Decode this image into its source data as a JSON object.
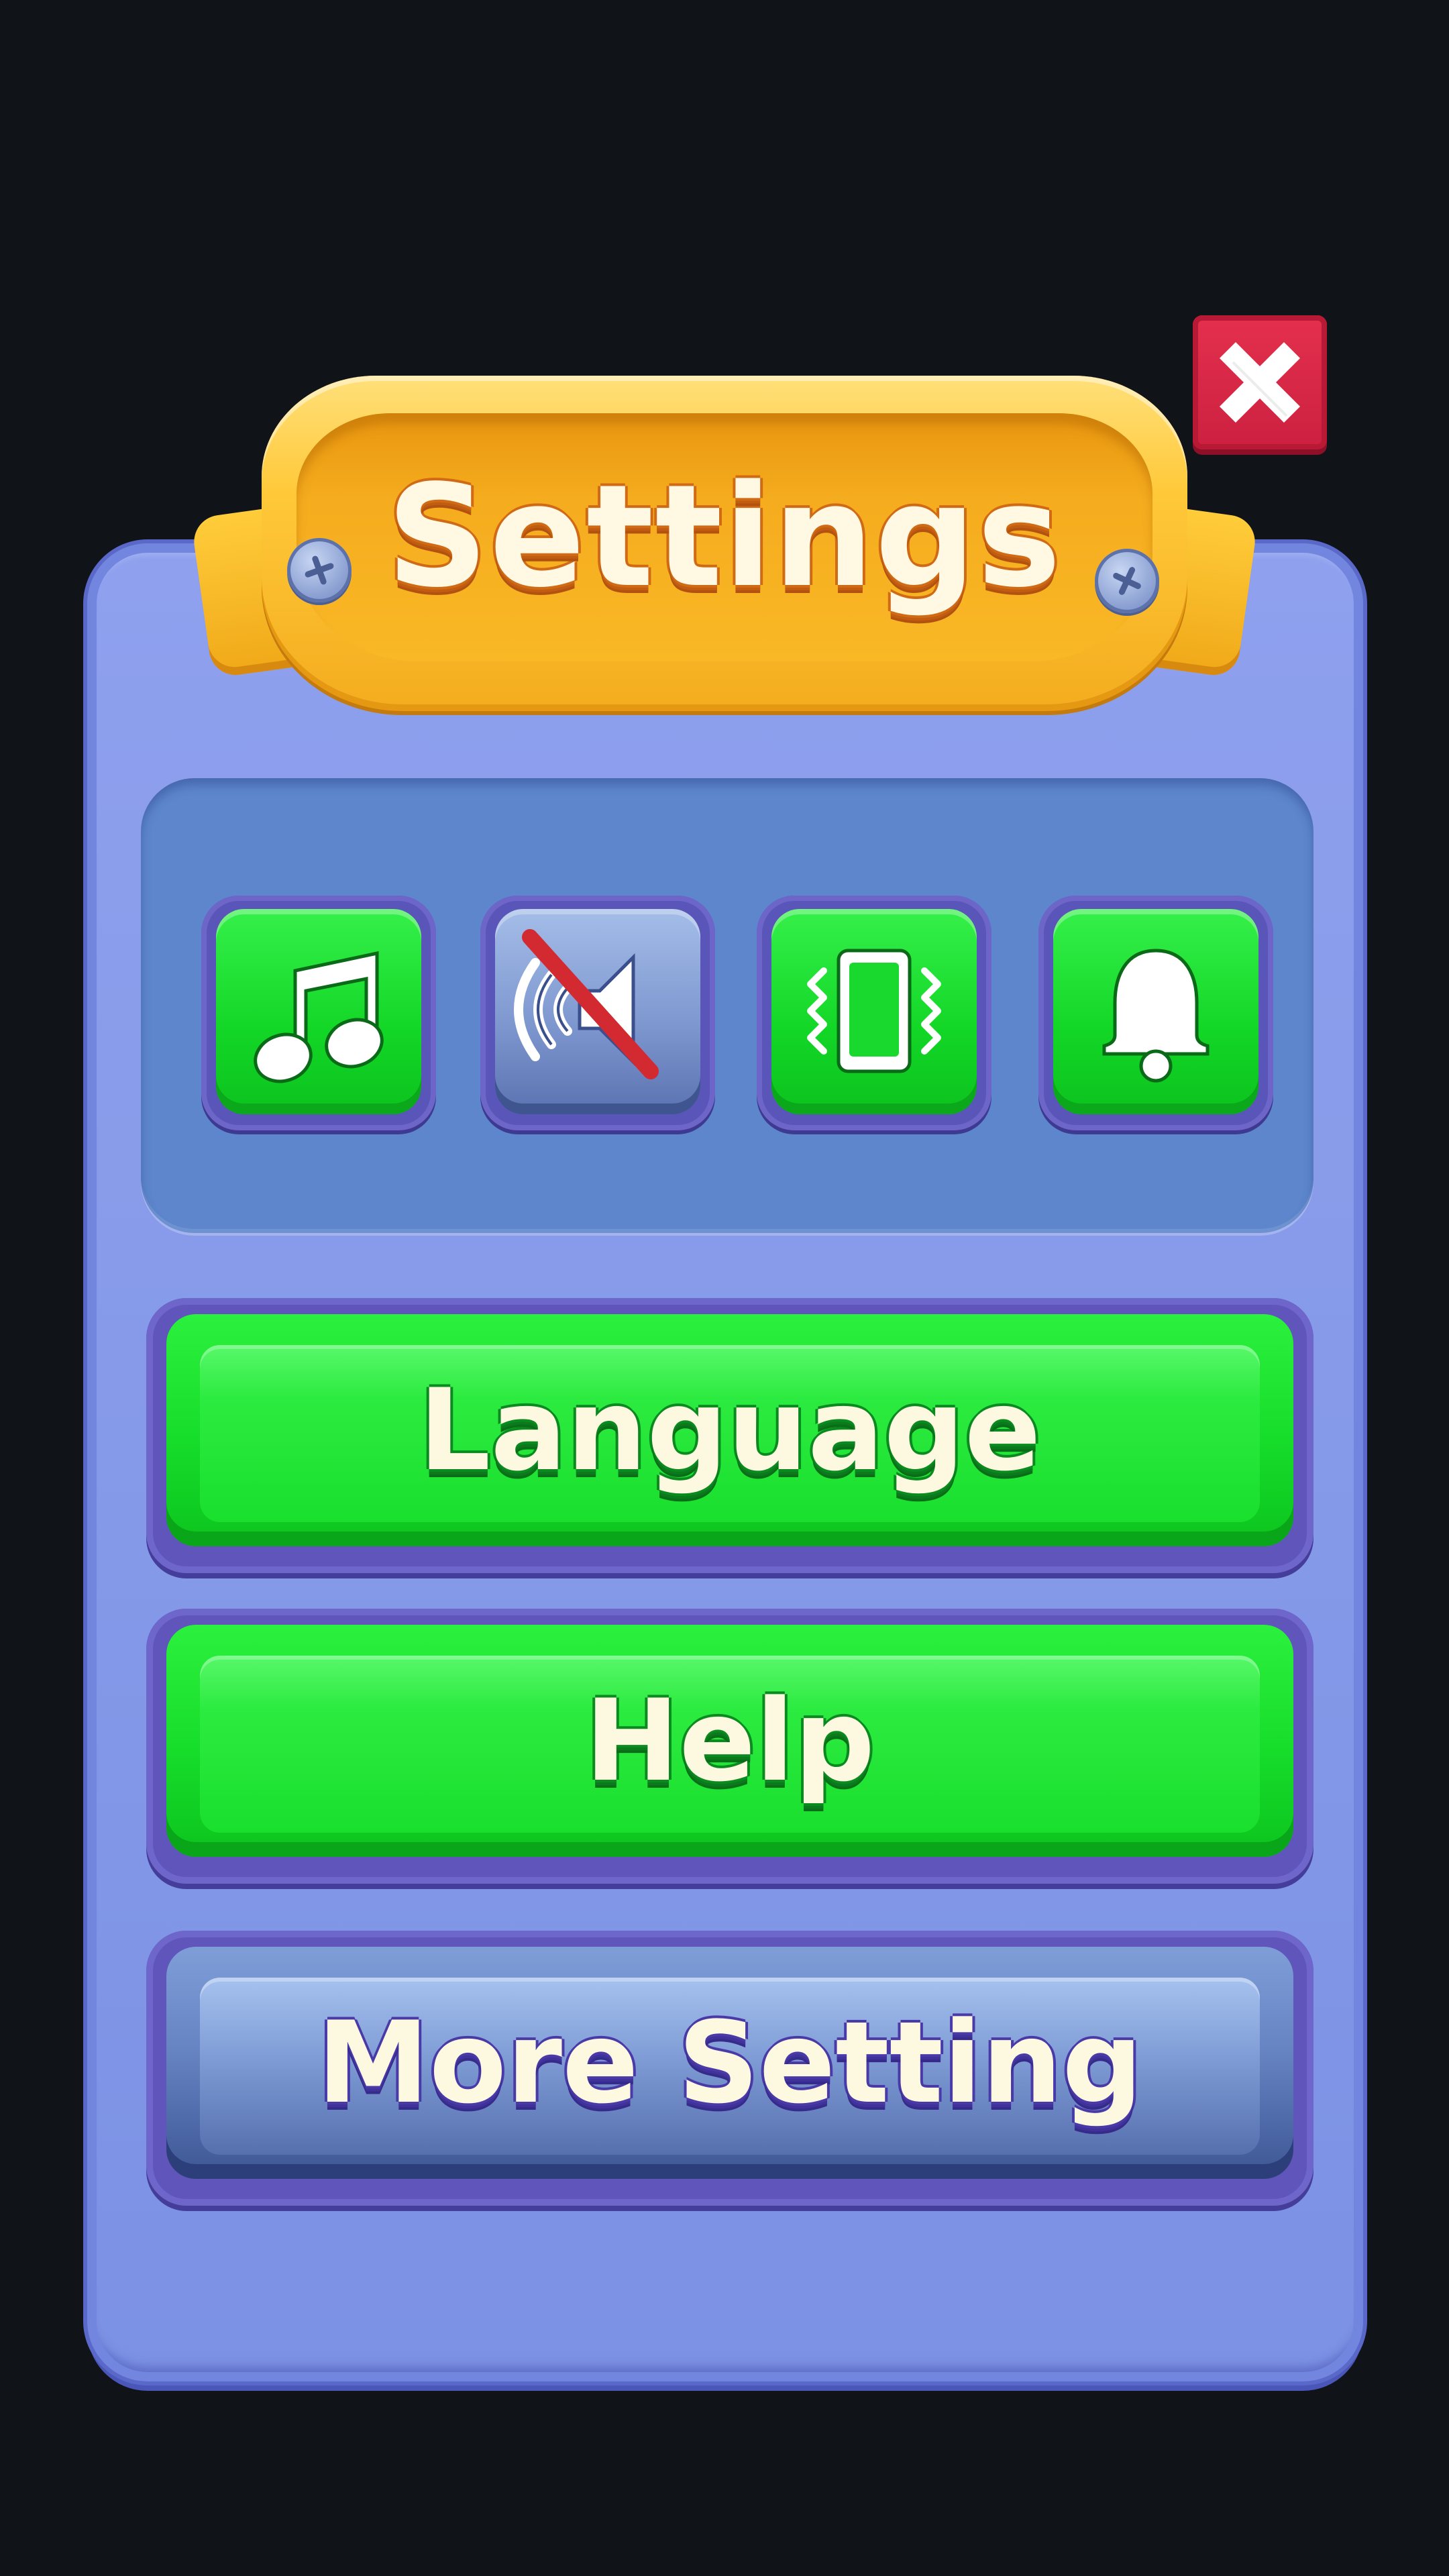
{
  "title": "Settings",
  "close_button": {
    "icon": "close-icon",
    "color": "#d8243f"
  },
  "toggles": [
    {
      "icon": "music-note-icon",
      "state": "on"
    },
    {
      "icon": "speaker-muted-icon",
      "state": "off"
    },
    {
      "icon": "phone-vibrate-icon",
      "state": "on"
    },
    {
      "icon": "bell-icon",
      "state": "on"
    }
  ],
  "buttons": {
    "language": "Language",
    "help": "Help",
    "more_setting": "More Setting"
  },
  "colors": {
    "panel": "#8a9cec",
    "banner": "#ffc23a",
    "toggle_on": "#18dc2c",
    "toggle_off": "#7f98d0",
    "button_green": "#16dc2a",
    "button_blue": "#6683c2"
  }
}
